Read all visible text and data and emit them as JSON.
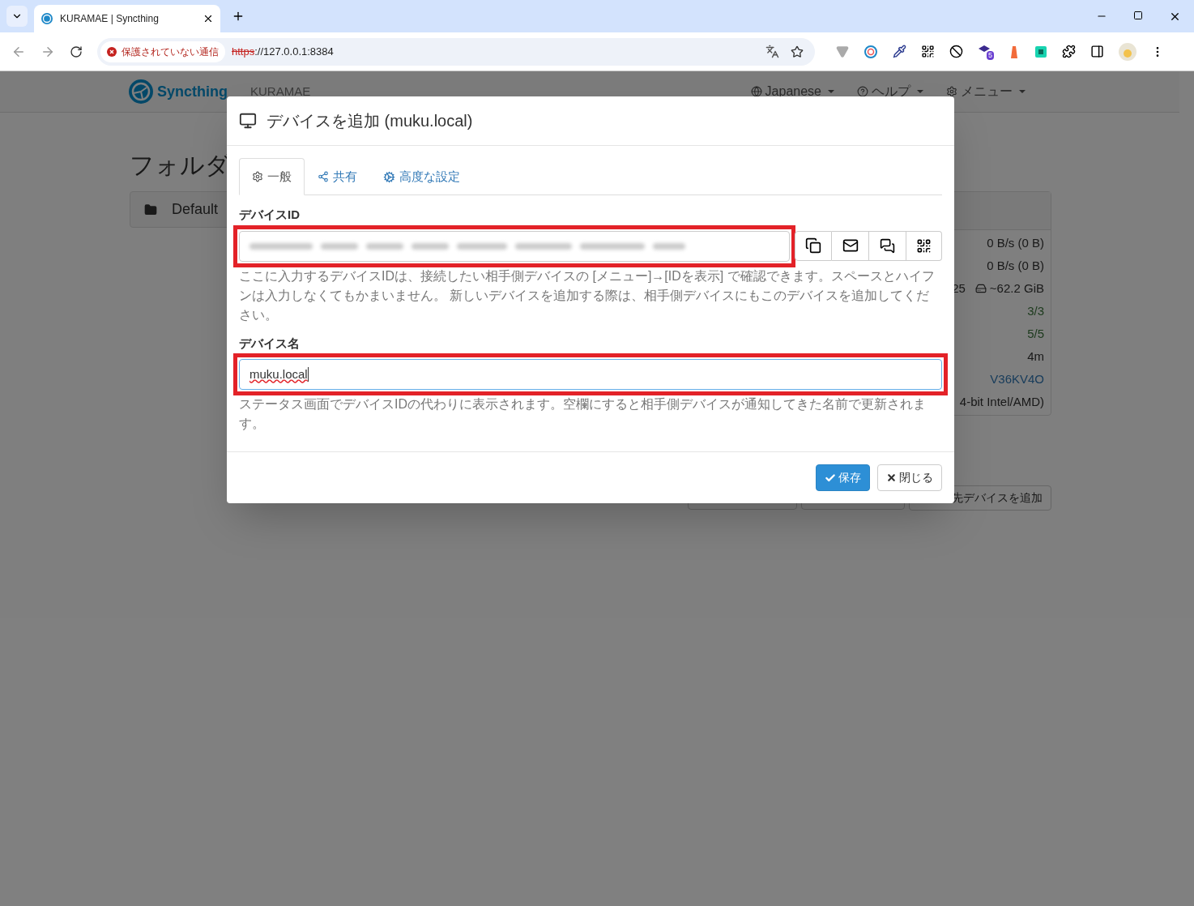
{
  "browser": {
    "tab_title": "KURAMAE | Syncthing",
    "security_label": "保護されていない通信",
    "url_scheme": "https",
    "url_rest": "://127.0.0.1:8384",
    "extension_badge": "5"
  },
  "navbar": {
    "brand": "Syncthing",
    "device_name": "KURAMAE",
    "menus": [
      {
        "label": "Japanese",
        "kind": "language"
      },
      {
        "label": "ヘルプ",
        "kind": "help"
      },
      {
        "label": "メニュー",
        "kind": "menu"
      }
    ]
  },
  "background": {
    "heading": "フォルダ",
    "folder_panel": "Default",
    "stats": [
      {
        "cells": [
          {
            "text": "0 B/s (0 B)",
            "kind": "text"
          }
        ]
      },
      {
        "cells": [
          {
            "text": "0 B/s (0 B)",
            "kind": "text"
          }
        ]
      },
      {
        "cells": [
          {
            "text": "25",
            "kind": "text"
          },
          {
            "text": "~62.2 GiB",
            "kind": "disk"
          }
        ]
      },
      {
        "cells": [
          {
            "text": "3/3",
            "kind": "success"
          }
        ]
      },
      {
        "cells": [
          {
            "text": "5/5",
            "kind": "success"
          }
        ]
      },
      {
        "cells": [
          {
            "text": "4m",
            "kind": "text"
          }
        ]
      },
      {
        "cells": [
          {
            "text": "V36KV4O",
            "kind": "link"
          }
        ]
      },
      {
        "cells": [
          {
            "text": "4-bit Intel/AMD)",
            "kind": "text"
          }
        ]
      }
    ],
    "action_button": "先デバイスを追加"
  },
  "modal": {
    "title": "デバイスを追加 (muku.local)",
    "tabs": [
      {
        "label": "一般",
        "kind": "general",
        "selected": true
      },
      {
        "label": "共有",
        "kind": "sharing",
        "selected": false
      },
      {
        "label": "高度な設定",
        "kind": "advanced",
        "selected": false
      }
    ],
    "device_id": {
      "label": "デバイスID",
      "highlighted": true,
      "help": "ここに入力するデバイスIDは、接続したい相手側デバイスの [メニュー]→[IDを表示] で確認できます。スペースとハイフンは入力しなくてもかまいません。 新しいデバイスを追加する際は、相手側デバイスにもこのデバイスを追加してください。"
    },
    "device_name": {
      "label": "デバイス名",
      "value": "muku.local",
      "highlighted": true,
      "misspelled": true,
      "help": "ステータス画面でデバイスIDの代わりに表示されます。空欄にすると相手側デバイスが通知してきた名前で更新されます。"
    },
    "buttons": [
      {
        "label": "保存",
        "kind": "primary"
      },
      {
        "label": "閉じる",
        "kind": "default"
      }
    ]
  }
}
